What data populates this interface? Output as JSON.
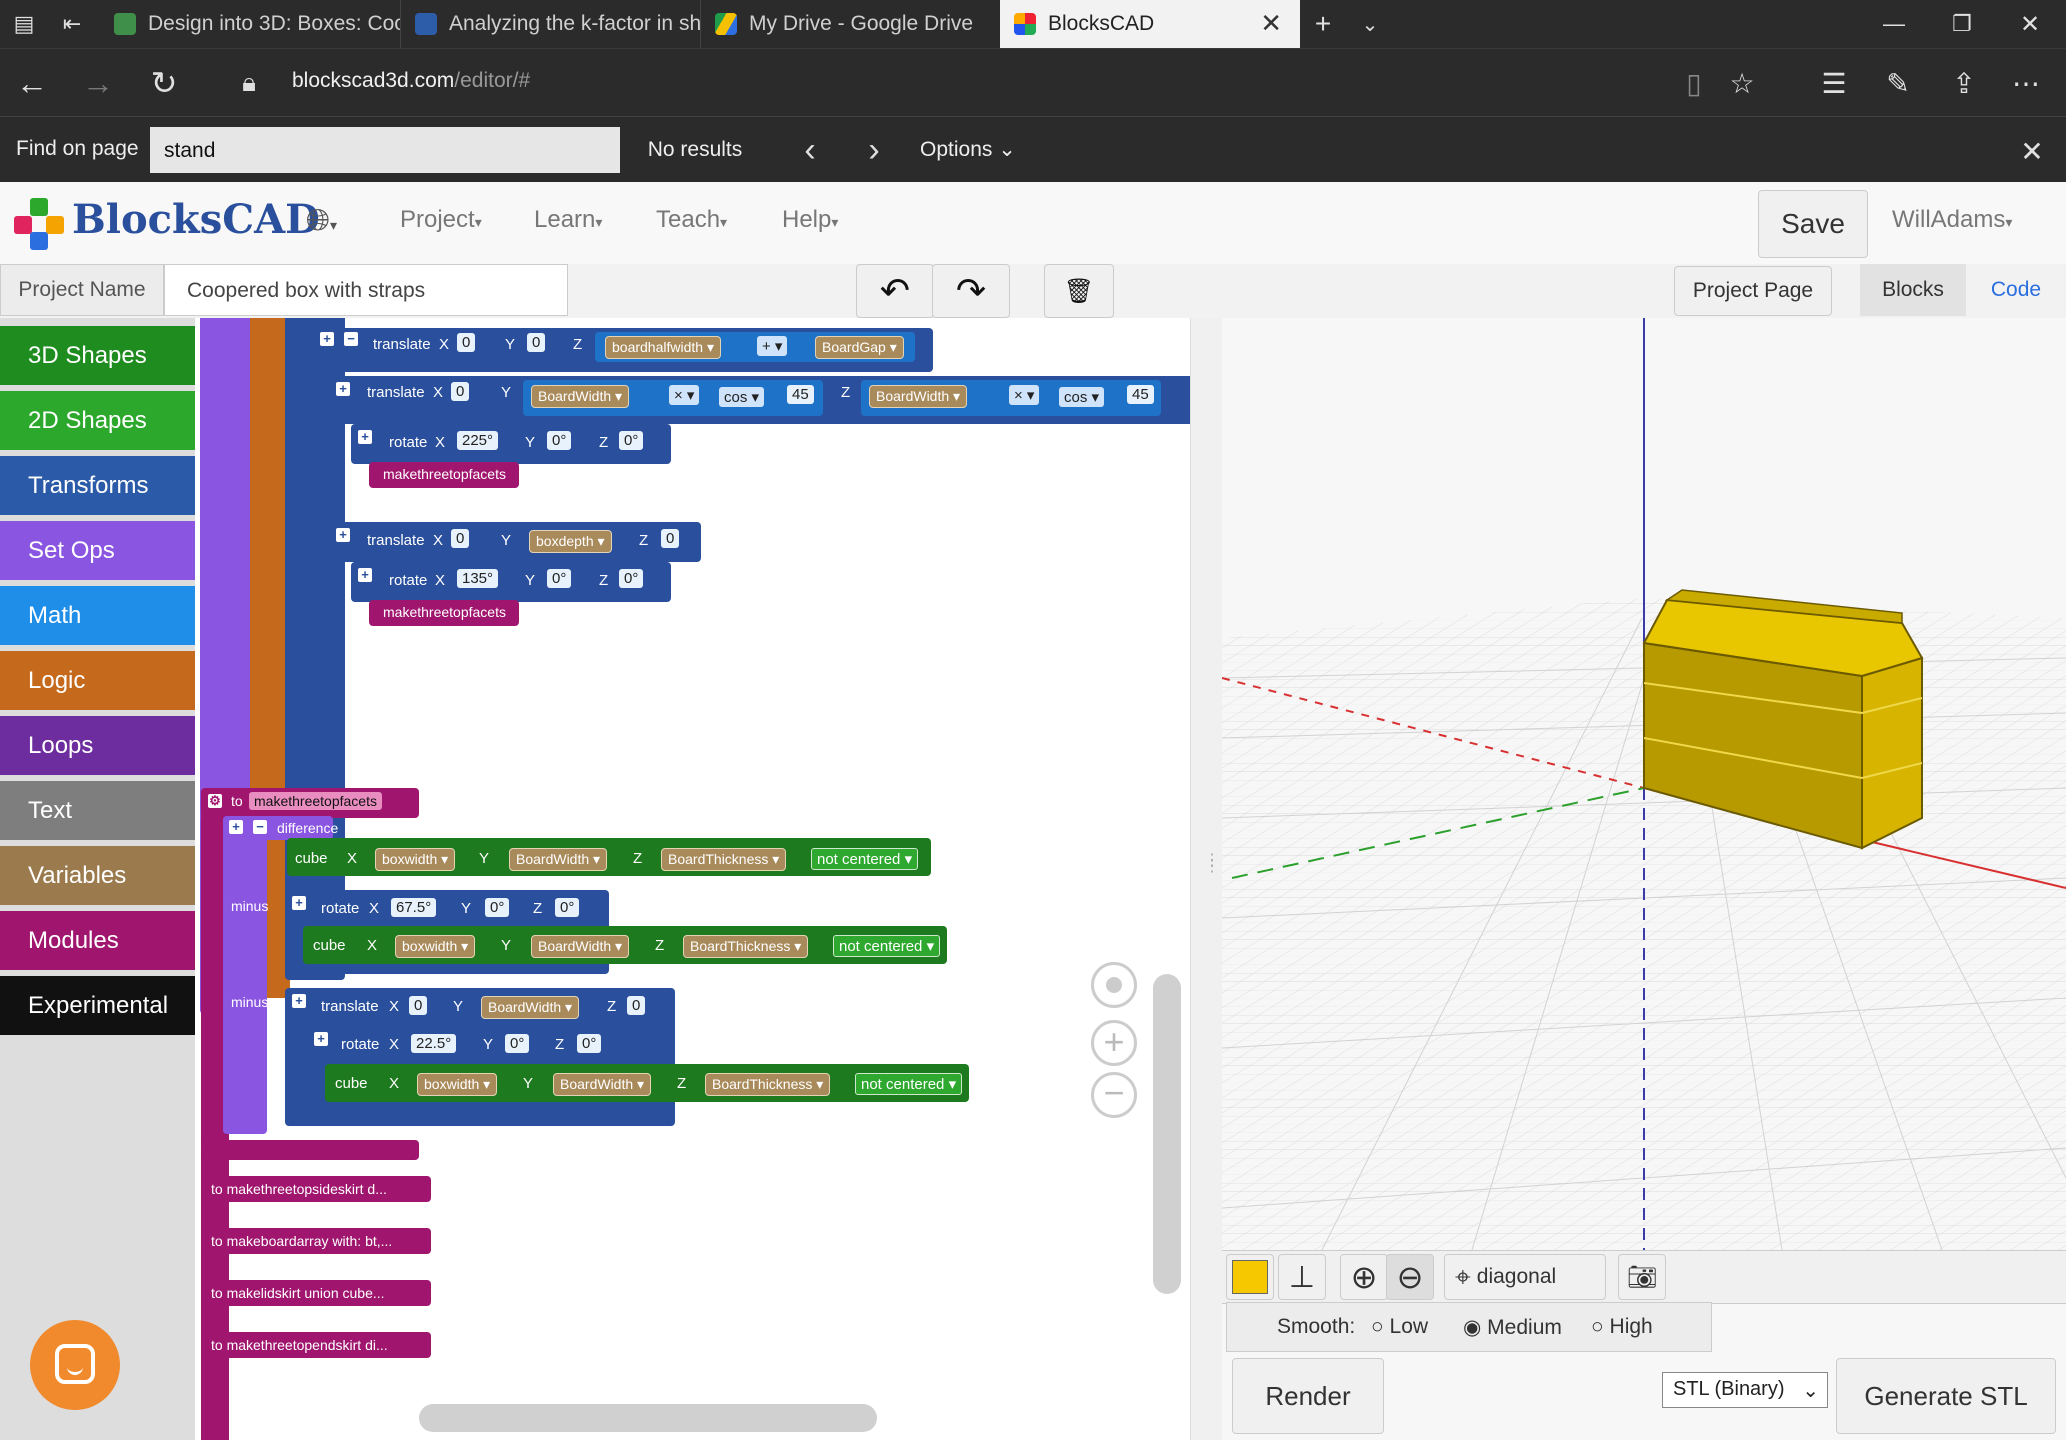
{
  "browser": {
    "tabs": [
      {
        "title": "Design into 3D: Boxes: Coo|"
      },
      {
        "title": "Analyzing the k-factor in sh"
      },
      {
        "title": "My Drive - Google Drive"
      },
      {
        "title": "BlocksCAD"
      }
    ],
    "url_host": "blockscad3d.com",
    "url_path": "/editor/#",
    "find": {
      "label": "Find on page",
      "query": "stand",
      "result": "No results",
      "options": "Options"
    }
  },
  "app": {
    "logo": "BlocksCAD",
    "nav": [
      "Project",
      "Learn",
      "Teach",
      "Help"
    ],
    "save": "Save",
    "user": "WillAdams",
    "project_name_label": "Project Name",
    "project_name": "Coopered box with straps",
    "project_page": "Project Page",
    "view_tabs": [
      "Blocks",
      "Code"
    ]
  },
  "toolbox": [
    {
      "label": "3D Shapes",
      "color": "#1e8c1e"
    },
    {
      "label": "2D Shapes",
      "color": "#2ca82c"
    },
    {
      "label": "Transforms",
      "color": "#2a5aa8"
    },
    {
      "label": "Set Ops",
      "color": "#8a55e0"
    },
    {
      "label": "Math",
      "color": "#1e8ee8"
    },
    {
      "label": "Logic",
      "color": "#c56a1c"
    },
    {
      "label": "Loops",
      "color": "#6d2d9e"
    },
    {
      "label": "Text",
      "color": "#7e7e7e"
    },
    {
      "label": "Variables",
      "color": "#9b7b4d"
    },
    {
      "label": "Modules",
      "color": "#a0156e"
    },
    {
      "label": "Experimental",
      "color": "#111111"
    }
  ],
  "blocks": {
    "b1": {
      "kw": "translate",
      "x": "0",
      "y": "0",
      "z_var1": "boardhalfwidth",
      "op": "+",
      "z_var2": "BoardGap"
    },
    "b2": {
      "kw": "translate",
      "x": "0",
      "y_var": "BoardWidth",
      "y_op": "×",
      "y_fn": "cos",
      "y_n": "45",
      "z_var": "BoardWidth",
      "z_op": "×",
      "z_fn": "cos",
      "z_n": "45"
    },
    "b3": {
      "kw": "rotate",
      "x": "225°",
      "y": "0°",
      "z": "0°",
      "call": "makethreetopfacets"
    },
    "b4": {
      "kw": "translate",
      "x": "0",
      "y_var": "boxdepth",
      "z": "0"
    },
    "b5": {
      "kw": "rotate",
      "x": "135°",
      "y": "0°",
      "z": "0°",
      "call": "makethreetopfacets"
    },
    "module": {
      "to": "to",
      "name": "makethreetopfacets",
      "difference": "difference",
      "minus": "minus"
    },
    "cube1": {
      "kw": "cube",
      "x": "boxwidth",
      "y": "BoardWidth",
      "z": "BoardThickness",
      "center": "not centered"
    },
    "rot1": {
      "kw": "rotate",
      "x": "67.5°",
      "y": "0°",
      "z": "0°"
    },
    "cube2": {
      "kw": "cube",
      "x": "boxwidth",
      "y": "BoardWidth",
      "z": "BoardThickness",
      "center": "not centered"
    },
    "tr2": {
      "kw": "translate",
      "x": "0",
      "y": "BoardWidth",
      "z": "0"
    },
    "rot2": {
      "kw": "rotate",
      "x": "22.5°",
      "y": "0°",
      "z": "0°"
    },
    "cube3": {
      "kw": "cube",
      "x": "boxwidth",
      "y": "BoardWidth",
      "z": "BoardThickness",
      "center": "not centered"
    },
    "collapsed": [
      "to makethreetopsideskirt  d...",
      "to makeboardarray with: bt,...",
      "to makelidskirt  union cube...",
      "to makethreetopendskirt  di..."
    ],
    "labels": {
      "X": "X",
      "Y": "Y",
      "Z": "Z"
    }
  },
  "viewer": {
    "view": "diagonal",
    "color_swatch": "#f5c800",
    "smooth_label": "Smooth:",
    "smooth_options": [
      "Low",
      "Medium",
      "High"
    ],
    "smooth_selected": "Medium",
    "render": "Render",
    "format": "STL (Binary)",
    "generate": "Generate STL"
  }
}
